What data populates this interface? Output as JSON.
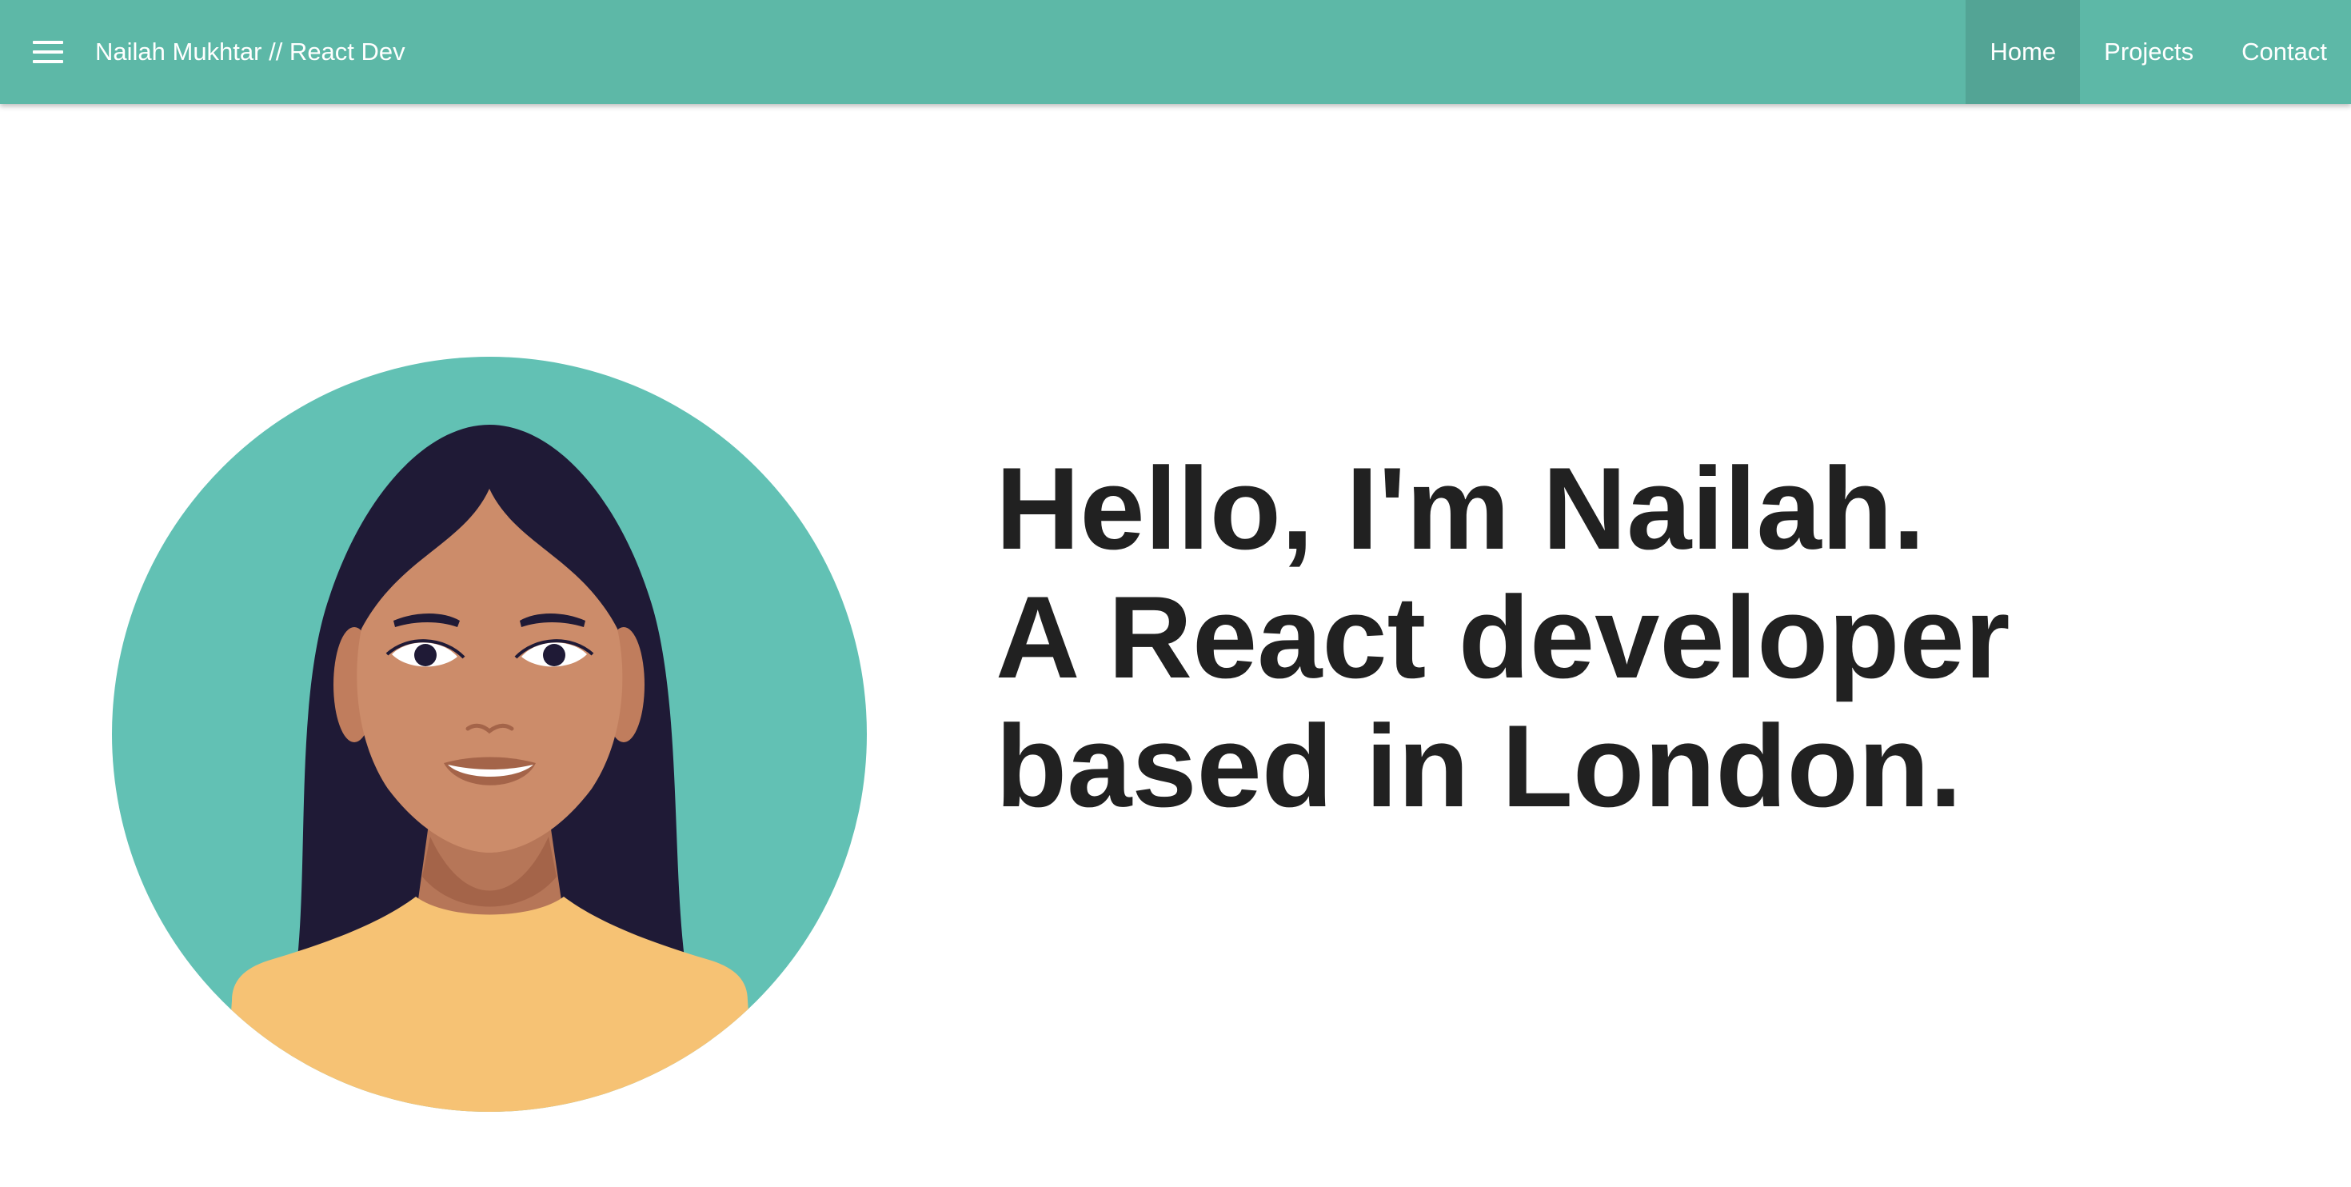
{
  "navbar": {
    "menu_icon": "hamburger-menu-icon",
    "brand": "Nailah Mukhtar // React Dev",
    "background": "#5db8a7",
    "active_background": "#53a495",
    "links": [
      {
        "label": "Home",
        "active": true
      },
      {
        "label": "Projects",
        "active": false
      },
      {
        "label": "Contact",
        "active": false
      }
    ]
  },
  "hero": {
    "line1": "Hello, I'm Nailah.",
    "line2": "A React developer",
    "line3": "based in London.",
    "text_color": "#212121"
  },
  "avatar": {
    "icon": "woman-portrait-illustration",
    "circle_color": "#62c1b4",
    "hair_color": "#1f1a36",
    "skin_color": "#cc8c6a",
    "shirt_color": "#f6c274"
  }
}
